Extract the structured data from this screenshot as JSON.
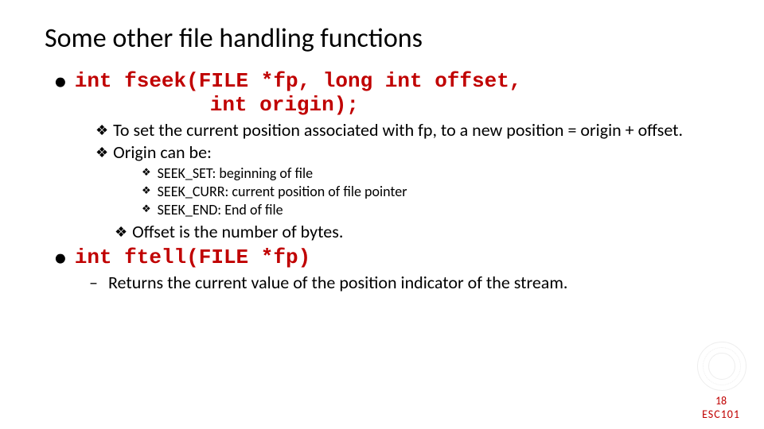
{
  "title": "Some other file handling functions",
  "fseek": {
    "sig_line1": "int fseek(FILE *fp, long int offset,",
    "sig_line2": "int origin);",
    "desc": "To set the current position associated with fp, to a new position = origin + offset.",
    "origin_label": "Origin can be:",
    "origins": [
      "SEEK_SET: beginning of file",
      "SEEK_CURR: current position of file pointer",
      "SEEK_END: End of file"
    ],
    "offset_note": "Offset is the number of bytes."
  },
  "ftell": {
    "sig": "int ftell(FILE *fp)",
    "desc": "Returns the current value of the position indicator of the stream."
  },
  "footer": {
    "page": "18",
    "course": "ESC101"
  }
}
